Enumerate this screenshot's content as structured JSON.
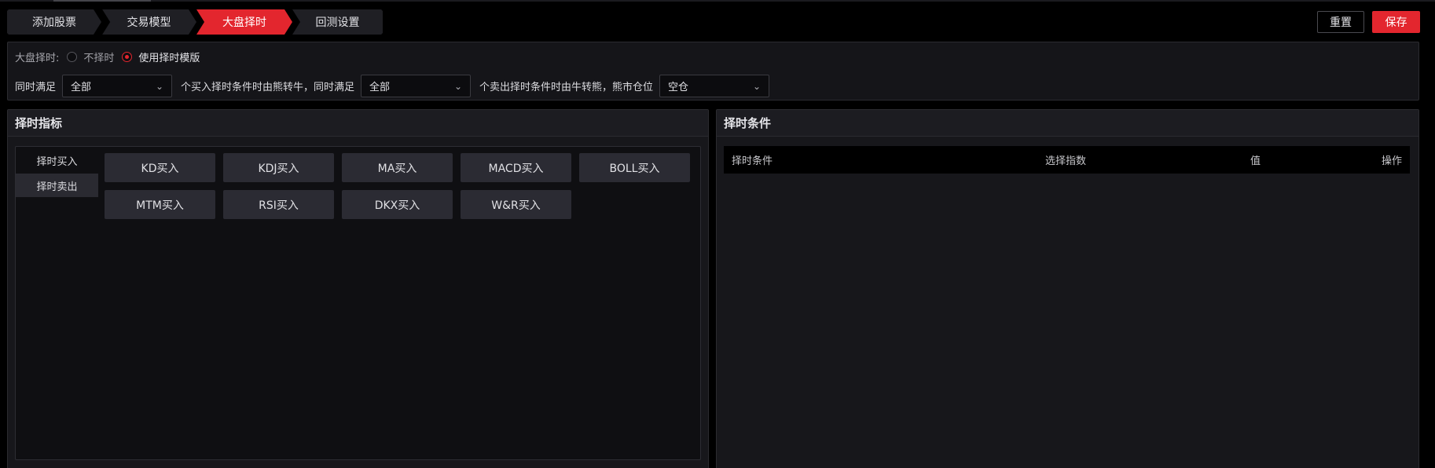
{
  "steps": [
    "添加股票",
    "交易模型",
    "大盘择时",
    "回测设置"
  ],
  "actions": {
    "reset": "重置",
    "save": "保存"
  },
  "timing": {
    "label": "大盘择时:",
    "options": [
      {
        "label": "不择时",
        "selected": false
      },
      {
        "label": "使用择时模版",
        "selected": true
      }
    ]
  },
  "conditions": {
    "prefix": "同时满足",
    "buy_select": "全部",
    "buy_text": "个买入择时条件时由熊转牛，同时满足",
    "sell_select": "全部",
    "sell_text": "个卖出择时条件时由牛转熊，熊市仓位",
    "position_select": "空仓"
  },
  "indicators_panel": {
    "title": "择时指标",
    "tabs": [
      {
        "label": "择时买入",
        "active": false
      },
      {
        "label": "择时卖出",
        "active": true
      }
    ],
    "buttons": [
      "KD买入",
      "KDJ买入",
      "MA买入",
      "MACD买入",
      "BOLL买入",
      "MTM买入",
      "RSI买入",
      "DKX买入",
      "W&R买入"
    ]
  },
  "conditions_panel": {
    "title": "择时条件",
    "columns": [
      "择时条件",
      "选择指数",
      "值",
      "操作"
    ]
  },
  "colors": {
    "accent": "#e3262e",
    "step_bg": "#1f1f24",
    "panel_bg": "#17171b"
  }
}
